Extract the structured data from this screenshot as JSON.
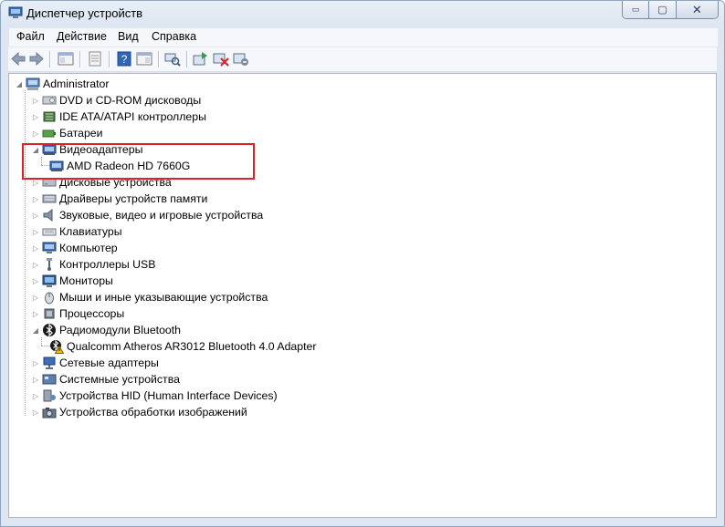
{
  "window": {
    "title": "Диспетчер устройств"
  },
  "caption": {
    "minimize": "▭",
    "maximize": "▢",
    "close": "✕"
  },
  "menu": [
    "Файл",
    "Действие",
    "Вид",
    "Справка"
  ],
  "toolbar": [
    "back-icon",
    "forward-icon",
    "properties-pane-icon",
    "show-hidden-icon",
    "help-icon",
    "console-tree-icon",
    "scan-hardware-icon",
    "update-driver-icon",
    "uninstall-device-icon",
    "disable-device-icon"
  ],
  "tree": {
    "root": "Administrator",
    "items": [
      {
        "label": "DVD и CD-ROM дисководы",
        "icon": "dvd-drive-icon"
      },
      {
        "label": "IDE ATA/ATAPI контроллеры",
        "icon": "ide-controller-icon"
      },
      {
        "label": "Батареи",
        "icon": "battery-icon"
      },
      {
        "label": "Видеоадаптеры",
        "icon": "display-adapter-icon",
        "expanded": true
      },
      {
        "label": "AMD Radeon HD 7660G",
        "icon": "display-adapter-icon",
        "child": true
      },
      {
        "label": "Дисковые устройства",
        "icon": "disk-drive-icon"
      },
      {
        "label": "Драйверы устройств памяти",
        "icon": "storage-driver-icon"
      },
      {
        "label": "Звуковые, видео и игровые устройства",
        "icon": "speaker-icon"
      },
      {
        "label": "Клавиатуры",
        "icon": "keyboard-icon"
      },
      {
        "label": "Компьютер",
        "icon": "computer-icon"
      },
      {
        "label": "Контроллеры USB",
        "icon": "usb-icon"
      },
      {
        "label": "Мониторы",
        "icon": "monitor-icon"
      },
      {
        "label": "Мыши и иные указывающие устройства",
        "icon": "mouse-icon"
      },
      {
        "label": "Процессоры",
        "icon": "processor-icon"
      },
      {
        "label": "Радиомодули Bluetooth",
        "icon": "bluetooth-icon",
        "expanded": true
      },
      {
        "label": "Qualcomm Atheros AR3012 Bluetooth 4.0 Adapter",
        "icon": "bluetooth-warning-icon",
        "child": true
      },
      {
        "label": "Сетевые адаптеры",
        "icon": "network-adapter-icon"
      },
      {
        "label": "Системные устройства",
        "icon": "system-device-icon"
      },
      {
        "label": "Устройства HID (Human Interface Devices)",
        "icon": "hid-icon"
      },
      {
        "label": "Устройства обработки изображений",
        "icon": "imaging-device-icon"
      }
    ]
  },
  "colors": {
    "highlight": "#d9222a",
    "accent": "#2b5797"
  }
}
